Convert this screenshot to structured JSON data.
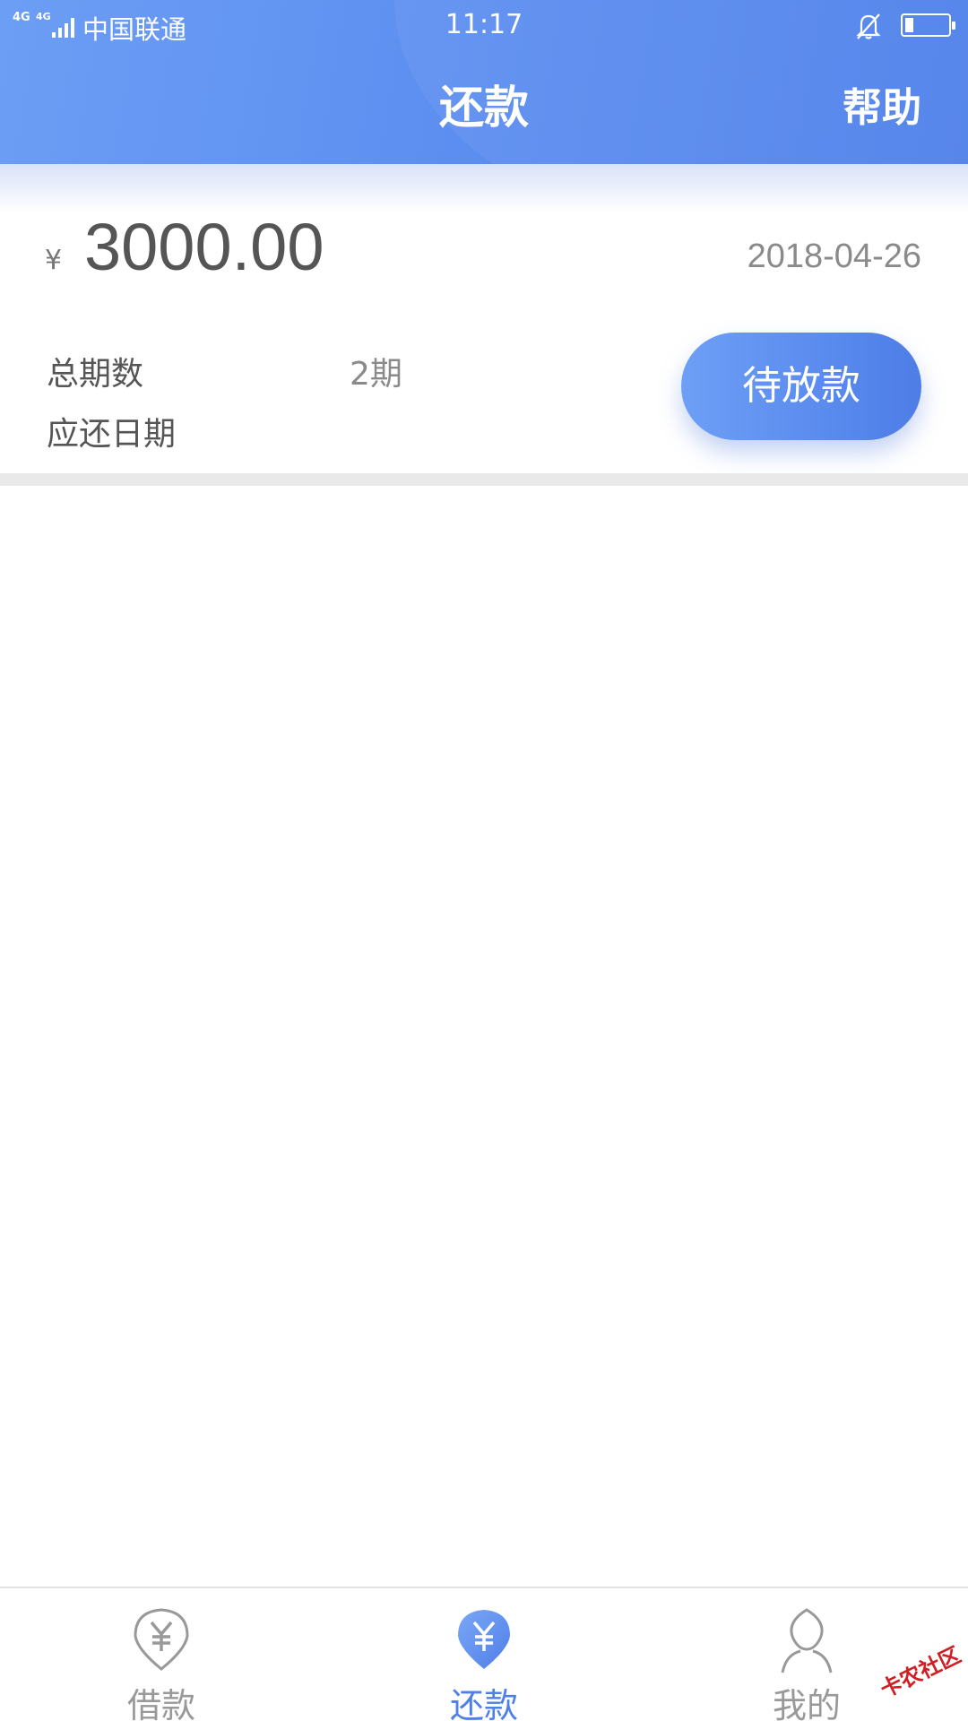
{
  "status_bar": {
    "network": "4G",
    "network2": "4G",
    "carrier": "中国联通",
    "time": "11:17",
    "battery_level_fraction": 0.2
  },
  "header": {
    "title": "还款",
    "help_label": "帮助"
  },
  "loan": {
    "currency_symbol": "¥",
    "amount": "3000.00",
    "date": "2018-04-26",
    "total_periods_label": "总期数",
    "total_periods_value": "2期",
    "due_date_label": "应还日期",
    "status_button_label": "待放款"
  },
  "tabbar": {
    "tabs": [
      {
        "label": "借款",
        "icon": "yuan-icon",
        "active": false
      },
      {
        "label": "还款",
        "icon": "yuan-icon",
        "active": true
      },
      {
        "label": "我的",
        "icon": "person-icon",
        "active": false
      }
    ]
  },
  "watermark": "卡农社区",
  "colors": {
    "primary": "#5a8cf0",
    "tab_active": "#4f7fe8",
    "tab_inactive": "#999999"
  }
}
